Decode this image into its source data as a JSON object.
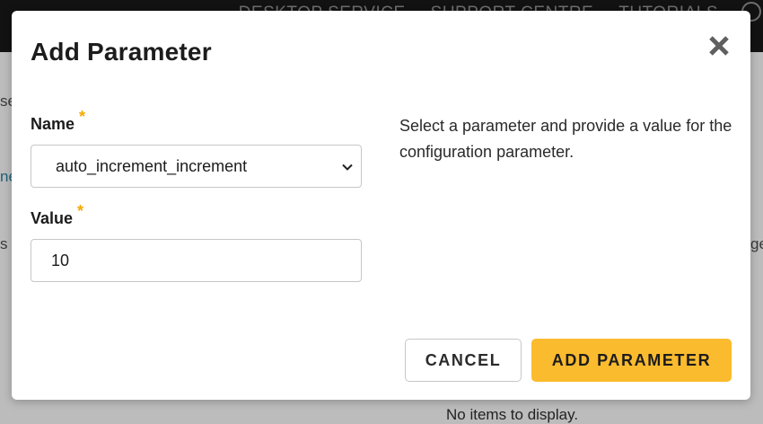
{
  "background": {
    "nav_items": [
      "DESKTOP SERVICE",
      "SUPPORT CENTRE",
      "TUTORIALS"
    ],
    "fragments": [
      "se",
      "ne",
      "s c",
      "ge"
    ],
    "empty_state": "No items to display."
  },
  "modal": {
    "title": "Add Parameter",
    "name_field": {
      "label": "Name",
      "required_marker": "*",
      "selected_value": "auto_increment_increment"
    },
    "value_field": {
      "label": "Value",
      "required_marker": "*",
      "value": "10"
    },
    "help_text": "Select a parameter and provide a value for the configuration parameter.",
    "cancel_label": "CANCEL",
    "submit_label": "ADD PARAMETER",
    "icons": {
      "close": "close-icon",
      "dropdown": "chevron-down-icon"
    },
    "colors": {
      "accent": "#fbbb2e",
      "required": "#f5a800"
    }
  }
}
